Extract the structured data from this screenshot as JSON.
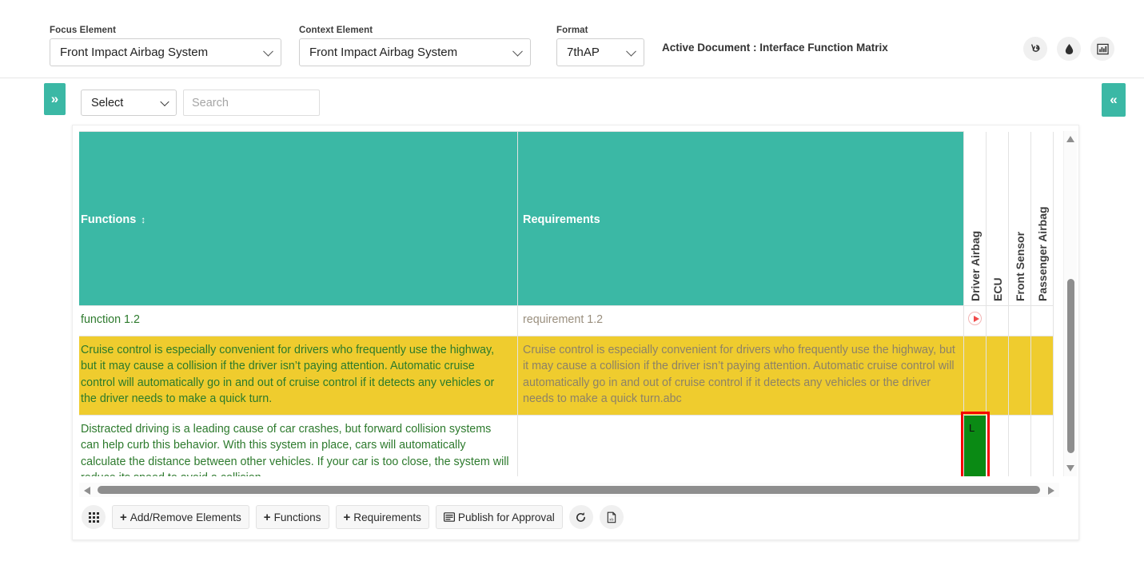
{
  "topbar": {
    "focus": {
      "label": "Focus Element",
      "value": "Front Impact Airbag System"
    },
    "context": {
      "label": "Context Element",
      "value": "Front Impact Airbag System"
    },
    "format": {
      "label": "Format",
      "value": "7thAP"
    },
    "active_document": "Active Document : Interface Function Matrix",
    "icons": [
      {
        "name": "vine-icon",
        "glyph": "Ѵ"
      },
      {
        "name": "water-drop-icon",
        "glyph": "◆"
      },
      {
        "name": "bar-chart-icon",
        "glyph": "ᴵ"
      }
    ]
  },
  "rails": {
    "left": "»",
    "right": "«"
  },
  "search": {
    "select_value": "Select",
    "placeholder": "Search"
  },
  "matrix": {
    "columns": {
      "functions": "Functions",
      "requirements": "Requirements",
      "sort_icon": "↕"
    },
    "vertical_columns": [
      "Driver Airbag",
      "ECU",
      "Front Sensor",
      "Passenger Airbag"
    ],
    "rows": [
      {
        "style": "white",
        "function": "function 1.2",
        "requirement": "requirement 1.2",
        "marks": [
          "arrow",
          "",
          "",
          ""
        ]
      },
      {
        "style": "yellow",
        "function": "Cruise control is especially convenient for drivers who frequently use the highway, but it may cause a collision if the driver isn’t paying attention. Automatic cruise control will automatically go in and out of cruise control if it detects any vehicles or the driver needs to make a quick turn.",
        "requirement": "Cruise control is especially convenient for drivers who frequently use the highway, but it may cause a collision if the driver isn’t paying attention. Automatic cruise control will automatically go in and out of cruise control if it detects any vehicles or the driver needs to make a quick turn.abc",
        "marks": [
          "",
          "",
          "",
          ""
        ]
      },
      {
        "style": "white",
        "function": "Distracted driving is a leading cause of car crashes, but forward collision systems can help curb this behavior. With this system in place, cars will automatically calculate the distance between other vehicles. If your car is too close, the system will reduce its speed to avoid a collision.",
        "requirement": "",
        "marks": [
          "L",
          "",
          "",
          ""
        ]
      }
    ]
  },
  "toolbar": {
    "grid_button": "grid-view",
    "add_remove_elements": "Add/Remove Elements",
    "functions": "Functions",
    "requirements": "Requirements",
    "publish": "Publish for Approval",
    "plus": "+",
    "publish_icon": "☰",
    "refresh_icon": "↻",
    "export_icon": "Ὄ4"
  },
  "colors": {
    "teal": "#3bb8a5",
    "yellow": "#efcc2e",
    "green_cell": "#0a8a14",
    "selection_red": "#f50000",
    "function_text": "#2d7a2d",
    "requirement_text": "#9a8f7e"
  }
}
